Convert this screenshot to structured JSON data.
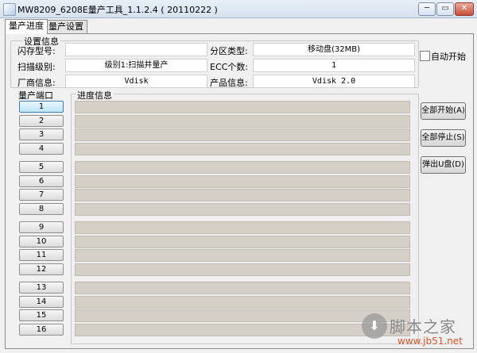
{
  "window": {
    "title": "MW8209_6208E量产工具_1.1.2.4 ( 20110222 )",
    "min_glyph": "─",
    "max_glyph": "▭",
    "close_glyph": "✕"
  },
  "tabs": [
    {
      "label": "量产进度"
    },
    {
      "label": "量产设置"
    }
  ],
  "settings": {
    "group_title": "设置信息",
    "flash_type_label": "闪存型号:",
    "flash_type_value": "",
    "scan_level_label": "扫描级别:",
    "scan_level_value": "级别1:扫描并量产",
    "vendor_label": "厂商信息:",
    "vendor_value": "Vdisk",
    "partition_label": "分区类型:",
    "partition_value": "移动盘(32MB)",
    "ecc_label": "ECC个数:",
    "ecc_value": "1",
    "product_label": "产品信息:",
    "product_value": "Vdisk 2.0"
  },
  "auto_start": {
    "label": "自动开始",
    "checked": false
  },
  "ports_title": "量产端口",
  "progress_title": "进度信息",
  "ports": [
    "1",
    "2",
    "3",
    "4",
    "5",
    "6",
    "7",
    "8",
    "9",
    "10",
    "11",
    "12",
    "13",
    "14",
    "15",
    "16"
  ],
  "buttons": {
    "start_all": "全部开始(A)",
    "stop_all": "全部停止(S)",
    "eject": "弹出U盘(D)"
  },
  "watermark": {
    "site_name": "脚本之家",
    "url": "www.jb51.net",
    "icon": "download-arrow-icon"
  }
}
